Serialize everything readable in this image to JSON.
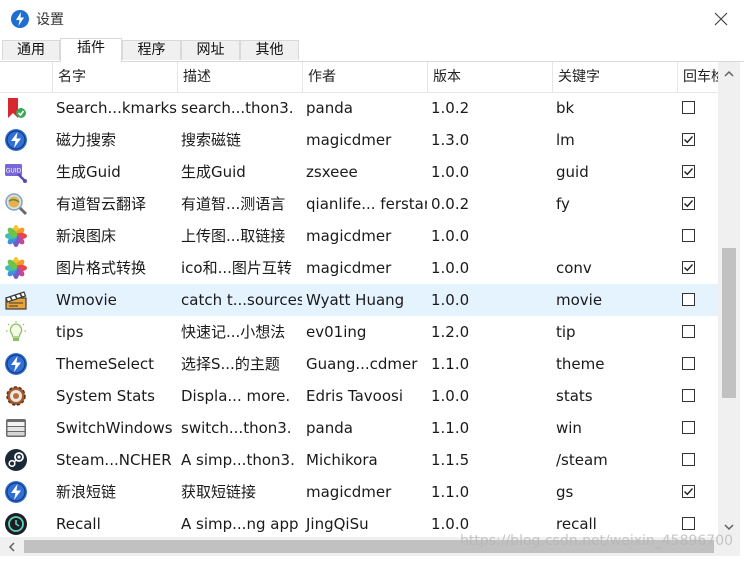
{
  "window": {
    "title": "设置"
  },
  "tabs": [
    {
      "label": "通用",
      "active": false
    },
    {
      "label": "插件",
      "active": true
    },
    {
      "label": "程序",
      "active": false
    },
    {
      "label": "网址",
      "active": false
    },
    {
      "label": "其他",
      "active": false
    }
  ],
  "columns": [
    "名字",
    "描述",
    "作者",
    "版本",
    "关键字",
    "回车检"
  ],
  "rows": [
    {
      "icon": "bookmark-icon",
      "name": "Search...kmarks",
      "desc": "search...thon3.",
      "author": "panda",
      "version": "1.0.2",
      "keyword": "bk",
      "checked": false,
      "selected": false
    },
    {
      "icon": "lightning-icon",
      "name": "磁力搜索",
      "desc": "搜索磁链",
      "author": "magicdmer",
      "version": "1.3.0",
      "keyword": "lm",
      "checked": true,
      "selected": false
    },
    {
      "icon": "guid-icon",
      "name": "生成Guid",
      "desc": "生成Guid",
      "author": "zsxeee",
      "version": "1.0.0",
      "keyword": "guid",
      "checked": true,
      "selected": false
    },
    {
      "icon": "magnifier-globe-icon",
      "name": "有道智云翻译",
      "desc": "有道智...测语言",
      "author": "qianlife... ferstar",
      "version": "0.0.2",
      "keyword": "fy",
      "checked": true,
      "selected": false
    },
    {
      "icon": "photos-flower-icon",
      "name": "新浪图床",
      "desc": "上传图...取链接",
      "author": "magicdmer",
      "version": "1.0.0",
      "keyword": "",
      "checked": false,
      "selected": false
    },
    {
      "icon": "photos-flower-icon",
      "name": "图片格式转换",
      "desc": "ico和...图片互转",
      "author": "magicdmer",
      "version": "1.0.0",
      "keyword": "conv",
      "checked": true,
      "selected": false
    },
    {
      "icon": "movie-clapper-icon",
      "name": "Wmovie",
      "desc": "catch t...sources",
      "author": "Wyatt Huang",
      "version": "1.0.0",
      "keyword": "movie",
      "checked": false,
      "selected": true
    },
    {
      "icon": "lightbulb-icon",
      "name": "tips",
      "desc": "快速记...小想法",
      "author": "ev01ing",
      "version": "1.2.0",
      "keyword": "tip",
      "checked": false,
      "selected": false
    },
    {
      "icon": "lightning-icon",
      "name": "ThemeSelect",
      "desc": "选择S...的主题",
      "author": "Guang...cdmer",
      "version": "1.1.0",
      "keyword": "theme",
      "checked": false,
      "selected": false
    },
    {
      "icon": "gear-chart-icon",
      "name": "System Stats",
      "desc": "Displa... more.",
      "author": "Edris Tavoosi",
      "version": "1.0.0",
      "keyword": "stats",
      "checked": false,
      "selected": false
    },
    {
      "icon": "windows-stack-icon",
      "name": "SwitchWindows",
      "desc": "switch...thon3.",
      "author": "panda",
      "version": "1.1.0",
      "keyword": "win",
      "checked": false,
      "selected": false
    },
    {
      "icon": "steam-icon",
      "name": "Steam...NCHER",
      "desc": "A simp...thon3.",
      "author": "Michikora",
      "version": "1.1.5",
      "keyword": "/steam",
      "checked": false,
      "selected": false
    },
    {
      "icon": "lightning-icon",
      "name": "新浪短链",
      "desc": "获取短链接",
      "author": "magicdmer",
      "version": "1.1.0",
      "keyword": "gs",
      "checked": true,
      "selected": false
    },
    {
      "icon": "recall-clock-icon",
      "name": "Recall",
      "desc": "A simp...ng app",
      "author": "JingQiSu",
      "version": "1.0.0",
      "keyword": "recall",
      "checked": false,
      "selected": false
    }
  ],
  "watermark": "https://blog.csdn.net/weixin_45896700",
  "colors": {
    "selected_row": "#e5f3ff",
    "accent": "#1e6fd0"
  }
}
